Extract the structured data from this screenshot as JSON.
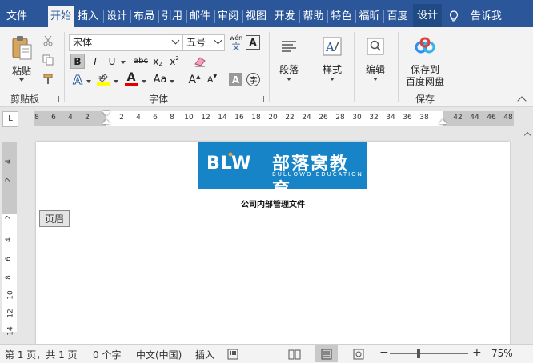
{
  "ribbon_tabs": [
    {
      "label": "文件",
      "active": false
    },
    {
      "label": "开始",
      "active": true
    },
    {
      "label": "插入",
      "active": false
    },
    {
      "label": "设计",
      "active": false
    },
    {
      "label": "布局",
      "active": false
    },
    {
      "label": "引用",
      "active": false
    },
    {
      "label": "邮件",
      "active": false
    },
    {
      "label": "审阅",
      "active": false
    },
    {
      "label": "视图",
      "active": false
    },
    {
      "label": "开发",
      "active": false
    },
    {
      "label": "帮助",
      "active": false
    },
    {
      "label": "特色",
      "active": false
    },
    {
      "label": "福昕",
      "active": false
    },
    {
      "label": "百度",
      "active": false
    },
    {
      "label": "设计",
      "active": false,
      "contextual": true
    }
  ],
  "tell_me": "告诉我",
  "clipboard": {
    "paste_label": "粘贴",
    "group_label": "剪贴板"
  },
  "font": {
    "font_name": "宋体",
    "font_size": "五号",
    "group_label": "字体",
    "bold": "B",
    "italic": "I",
    "underline": "U",
    "strikethrough": "abc",
    "subscript": "x",
    "superscript": "x",
    "change_case": "Aa",
    "grow": "A",
    "shrink": "A",
    "wen_top": "wén",
    "wen_bottom": "文",
    "char_border": "A",
    "char_shading": "A",
    "enclosed": "字",
    "font_color": "A",
    "highlight_color": "#ffff00",
    "font_color_value": "#e00000"
  },
  "paragraph": {
    "label": "段落"
  },
  "styles": {
    "label": "样式"
  },
  "editing": {
    "label": "编辑"
  },
  "save": {
    "line1": "保存到",
    "line2": "百度网盘",
    "group_label": "保存"
  },
  "ruler": {
    "corner": "L",
    "h_ticks": [
      "8",
      "6",
      "4",
      "2",
      "2",
      "4",
      "6",
      "8",
      "10",
      "12",
      "14",
      "16",
      "18",
      "20",
      "22",
      "24",
      "26",
      "28",
      "30",
      "32",
      "34",
      "36",
      "38",
      "42",
      "44",
      "46",
      "48"
    ],
    "v_ticks": [
      "4",
      "2",
      "2",
      "4",
      "6",
      "8",
      "10",
      "12",
      "14"
    ]
  },
  "document": {
    "logo_cn": "部落窝教育",
    "logo_en": "BULUOWO EDUCATION",
    "logo_mark": "BLW",
    "header_text": "公司内部管理文件",
    "header_tag": "页眉"
  },
  "status_bar": {
    "page": "第 1 页，共 1 页",
    "words": "0 个字",
    "language": "中文(中国)",
    "mode": "插入",
    "zoom_minus": "−",
    "zoom_plus": "+",
    "zoom": "75%"
  },
  "colors": {
    "accent": "#2b579a",
    "logo_bg": "#1784c7"
  }
}
